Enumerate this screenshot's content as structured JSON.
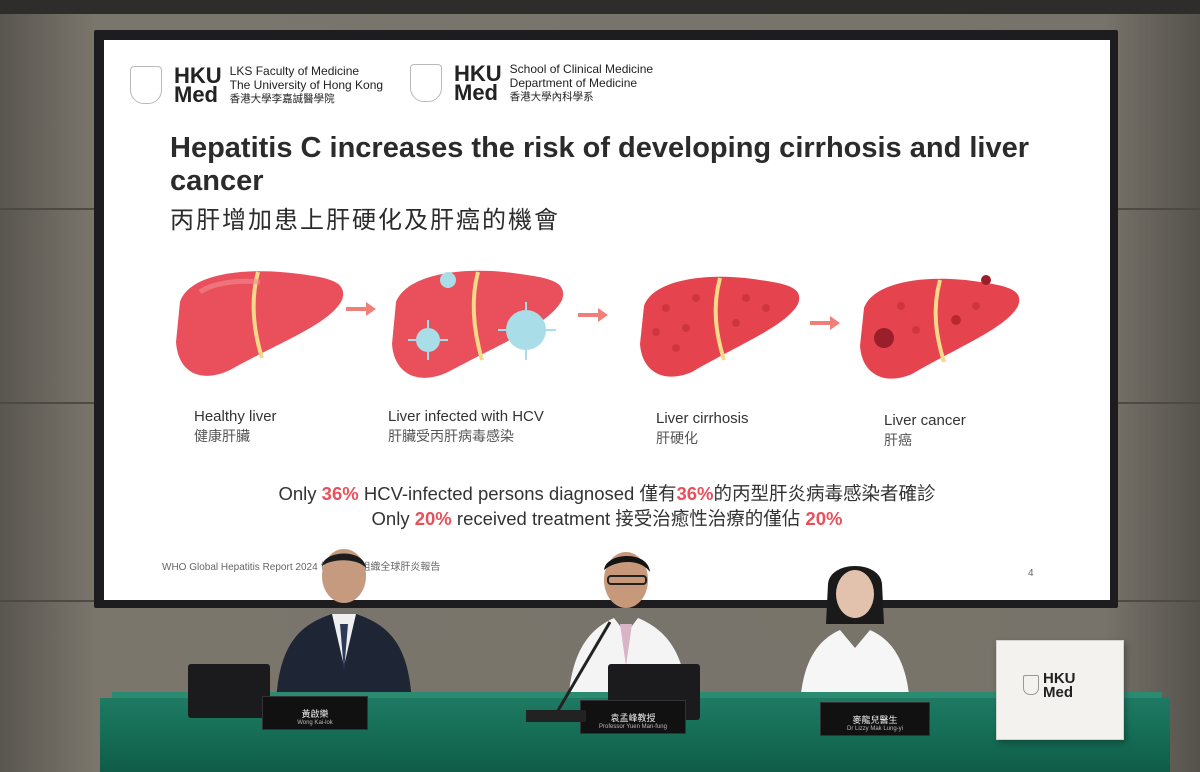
{
  "logos": {
    "left": {
      "brand_top": "HKU",
      "brand_bottom": "Med",
      "line1": "LKS Faculty of Medicine",
      "line2": "The University of Hong Kong",
      "line3": "香港大學李嘉誠醫學院"
    },
    "right": {
      "brand_top": "HKU",
      "brand_bottom": "Med",
      "line1": "School of Clinical Medicine",
      "line2": "Department of Medicine",
      "line3": "香港大學內科學系"
    }
  },
  "slide": {
    "title_en": "Hepatitis C increases the risk of developing cirrhosis and liver cancer",
    "title_zh": "丙肝增加患上肝硬化及肝癌的機會",
    "stages": [
      {
        "en": "Healthy liver",
        "zh": "健康肝臟"
      },
      {
        "en": "Liver infected with HCV",
        "zh": "肝臟受丙肝病毒感染"
      },
      {
        "en": "Liver cirrhosis",
        "zh": "肝硬化"
      },
      {
        "en": "Liver cancer",
        "zh": "肝癌"
      }
    ],
    "stat1": {
      "pre": "Only ",
      "pct": "36%",
      "mid": " HCV-infected persons diagnosed 僅有",
      "pct_zh": "36%",
      "post": "的丙型肝炎病毒感染者確診"
    },
    "stat2": {
      "pre": "Only ",
      "pct": "20%",
      "mid": " received treatment 接受治癒性治療的僅佔 ",
      "pct_zh": "20%"
    },
    "footer": "WHO Global Hepatitis Report 2024 世界衞生組織全球肝炎報告",
    "page_number": "4"
  },
  "nameplates": {
    "left": {
      "zh": "黃啟樂",
      "en": "Wong Kai-lok"
    },
    "center": {
      "zh": "袁孟峰教授",
      "en": "Professor Yuen Man-fung"
    },
    "right": {
      "zh": "麥龍兒醫生",
      "en": "Dr Lizzy Mak Lung-yi"
    }
  },
  "box": {
    "brand_top": "HKU",
    "brand_bottom": "Med"
  },
  "colors": {
    "liver": "#e9505b",
    "highlight": "#e8505b",
    "table": "#177058",
    "virus": "#a9dde7"
  }
}
